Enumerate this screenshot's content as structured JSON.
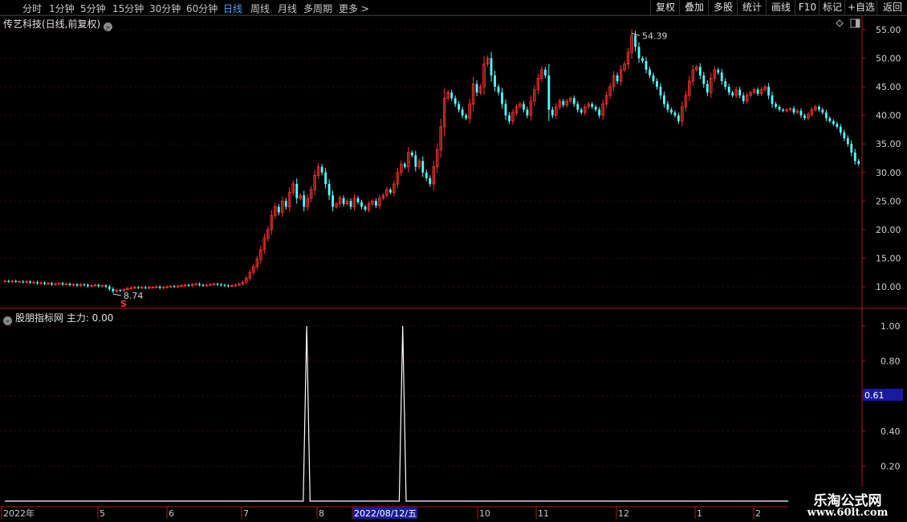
{
  "toolbar": {
    "periods": [
      {
        "label": "分时",
        "active": false
      },
      {
        "label": "1分钟",
        "active": false
      },
      {
        "label": "5分钟",
        "active": false
      },
      {
        "label": "15分钟",
        "active": false
      },
      {
        "label": "30分钟",
        "active": false
      },
      {
        "label": "60分钟",
        "active": false
      },
      {
        "label": "日线",
        "active": true
      },
      {
        "label": "周线",
        "active": false
      },
      {
        "label": "月线",
        "active": false
      },
      {
        "label": "多周期",
        "active": false
      },
      {
        "label": "更多 >",
        "active": false
      }
    ],
    "tools": [
      "复权",
      "叠加",
      "多股",
      "统计",
      "画线",
      "F10",
      "标记",
      "+自选",
      "返回"
    ]
  },
  "stock": {
    "title": "传艺科技(日线,前复权)",
    "high_label": "54.39",
    "low_label": "8.74",
    "price_axis": [
      "55.00",
      "50.00",
      "45.00",
      "40.00",
      "35.00",
      "30.00",
      "25.00",
      "20.00",
      "15.00",
      "10.00"
    ],
    "marker": "S"
  },
  "indicator": {
    "title": "股朋指标网 主力: 0.00",
    "axis": [
      "1.00",
      "0.80",
      "0.60",
      "0.40",
      "0.20"
    ],
    "current_value": "0.61"
  },
  "time_axis": {
    "labels": [
      "2022年",
      "5",
      "6",
      "7",
      "8",
      "2022/08/12/五",
      "10",
      "11",
      "12",
      "1",
      "2"
    ],
    "highlight": "2022/08/12/五"
  },
  "colors": {
    "up": "#ff3232",
    "down": "#54ffff",
    "axis": "#b01818",
    "grid": "#3a0a0a",
    "active": "#4fa3ff",
    "highlight_bg": "#1a1aa0"
  },
  "watermark": {
    "line1": "乐淘公式网",
    "line2": "www.60lt.com"
  },
  "chart_data": [
    {
      "type": "candlestick",
      "title": "传艺科技(日线,前复权)",
      "ylim": [
        7,
        57
      ],
      "x_labels": [
        "2022年",
        "5",
        "6",
        "7",
        "8",
        "2022/08/12/五",
        "10",
        "11",
        "12",
        "1",
        "2"
      ],
      "close": [
        11.0,
        10.9,
        11.0,
        10.9,
        10.9,
        10.8,
        10.9,
        10.7,
        10.8,
        10.6,
        10.7,
        10.5,
        10.6,
        10.4,
        10.5,
        10.6,
        10.4,
        10.5,
        10.3,
        10.4,
        10.2,
        10.4,
        10.3,
        10.1,
        10.2,
        10.3,
        10.1,
        10.2,
        10.0,
        9.6,
        9.2,
        9.4,
        9.3,
        9.5,
        9.7,
        9.8,
        9.9,
        9.8,
        9.9,
        9.8,
        9.9,
        9.9,
        10.0,
        9.8,
        9.9,
        10.0,
        10.1,
        10.0,
        10.1,
        10.2,
        10.3,
        10.2,
        10.4,
        10.5,
        10.3,
        10.2,
        10.3,
        10.4,
        10.5,
        10.4,
        10.3,
        10.2,
        10.1,
        10.2,
        10.3,
        10.5,
        10.8,
        11.5,
        12.5,
        13.5,
        14.8,
        16.5,
        18.5,
        20.0,
        22.5,
        24.0,
        23.0,
        25.0,
        24.0,
        26.5,
        28.0,
        25.5,
        26.0,
        24.0,
        25.5,
        27.0,
        29.5,
        31.0,
        30.0,
        28.0,
        26.0,
        24.0,
        24.5,
        25.5,
        24.5,
        25.0,
        24.0,
        25.5,
        24.8,
        24.0,
        23.5,
        24.5,
        25.0,
        24.2,
        25.5,
        26.0,
        27.0,
        26.5,
        28.0,
        30.0,
        31.5,
        31.0,
        33.5,
        33.0,
        31.0,
        32.0,
        30.0,
        29.0,
        28.0,
        31.0,
        34.0,
        38.0,
        43.0,
        44.0,
        43.0,
        42.0,
        41.0,
        40.0,
        39.5,
        42.0,
        45.5,
        44.0,
        45.0,
        49.0,
        50.0,
        47.0,
        45.0,
        44.0,
        42.0,
        40.0,
        39.0,
        40.5,
        41.5,
        42.0,
        41.0,
        40.0,
        42.5,
        44.5,
        46.5,
        48.0,
        47.0,
        41.0,
        40.0,
        41.5,
        42.5,
        41.8,
        42.5,
        43.0,
        42.0,
        41.0,
        40.5,
        41.5,
        42.0,
        41.5,
        41.0,
        40.0,
        42.0,
        43.5,
        45.0,
        47.0,
        46.0,
        48.0,
        49.0,
        51.0,
        54.0,
        52.0,
        50.0,
        49.5,
        48.0,
        47.0,
        46.0,
        45.0,
        43.5,
        42.0,
        41.0,
        40.5,
        40.0,
        39.0,
        41.5,
        43.5,
        46.0,
        48.0,
        48.5,
        47.0,
        45.5,
        44.0,
        46.5,
        48.0,
        47.5,
        46.0,
        45.0,
        44.0,
        43.5,
        44.5,
        43.5,
        42.5,
        43.5,
        44.0,
        44.5,
        43.8,
        44.5,
        45.0,
        43.5,
        42.0,
        41.5,
        41.0,
        40.8,
        41.0,
        41.2,
        40.5,
        40.8,
        40.0,
        39.5,
        40.2,
        41.0,
        41.5,
        41.0,
        40.5,
        39.5,
        39.0,
        38.5,
        38.0,
        37.0,
        36.0,
        35.0,
        33.5,
        32.0,
        31.5
      ],
      "extremes": {
        "high": 54.39,
        "low": 8.74
      }
    },
    {
      "type": "line",
      "title": "股朋指标网 主力: 0.00",
      "ylim": [
        0,
        1.05
      ],
      "values": [
        0,
        0,
        0,
        0,
        0,
        0,
        0,
        0,
        0,
        0,
        0,
        0,
        0,
        0,
        0,
        0,
        0,
        0,
        0,
        0,
        0,
        0,
        0,
        0,
        0,
        0,
        0,
        0,
        0,
        0,
        0,
        0,
        0,
        0,
        0,
        0,
        0,
        0,
        0,
        0,
        0,
        0,
        0,
        0,
        0,
        0,
        0,
        0,
        0,
        0,
        0,
        0,
        0,
        0,
        0,
        0,
        0,
        0,
        0,
        0,
        0,
        0,
        0,
        0,
        0,
        0,
        0,
        0,
        0,
        0,
        0,
        0,
        0,
        0,
        0,
        0,
        0,
        0,
        0,
        0,
        0,
        0,
        0,
        0,
        0,
        0,
        0,
        0,
        1,
        0,
        0,
        0,
        0,
        0,
        0,
        0,
        0,
        0,
        0,
        0,
        0,
        0,
        0,
        0,
        0,
        0,
        0,
        0,
        0,
        0,
        0,
        0,
        0,
        0,
        0,
        0,
        1,
        0,
        0,
        0,
        0,
        0,
        0,
        0,
        0,
        0,
        0,
        0,
        0,
        0,
        0,
        0,
        0,
        0,
        0,
        0,
        0,
        0,
        0,
        0,
        0,
        0,
        0,
        0,
        0,
        0,
        0,
        0,
        0,
        0,
        0,
        0,
        0,
        0,
        0,
        0,
        0,
        0,
        0,
        0,
        0,
        0,
        0,
        0,
        0,
        0,
        0,
        0,
        0,
        0,
        0,
        0,
        0,
        0,
        0,
        0,
        0,
        0,
        0,
        0,
        0,
        0,
        0,
        0,
        0,
        0,
        0,
        0,
        0,
        0,
        0,
        0,
        0,
        0,
        0,
        0,
        0,
        0,
        0,
        0,
        0,
        0,
        0,
        0,
        0,
        0,
        0,
        0,
        0,
        0,
        0,
        0,
        0,
        0,
        0,
        0,
        0,
        0,
        0,
        0,
        0,
        0,
        0,
        0,
        0,
        0,
        0,
        0,
        0,
        0,
        0,
        0,
        0,
        0,
        0,
        0,
        0,
        0,
        0,
        0,
        0,
        0,
        0,
        0,
        0,
        0,
        0,
        0,
        0,
        0
      ],
      "axis": [
        "1.00",
        "0.80",
        "0.60",
        "0.40",
        "0.20"
      ],
      "current_value": 0.61
    }
  ]
}
